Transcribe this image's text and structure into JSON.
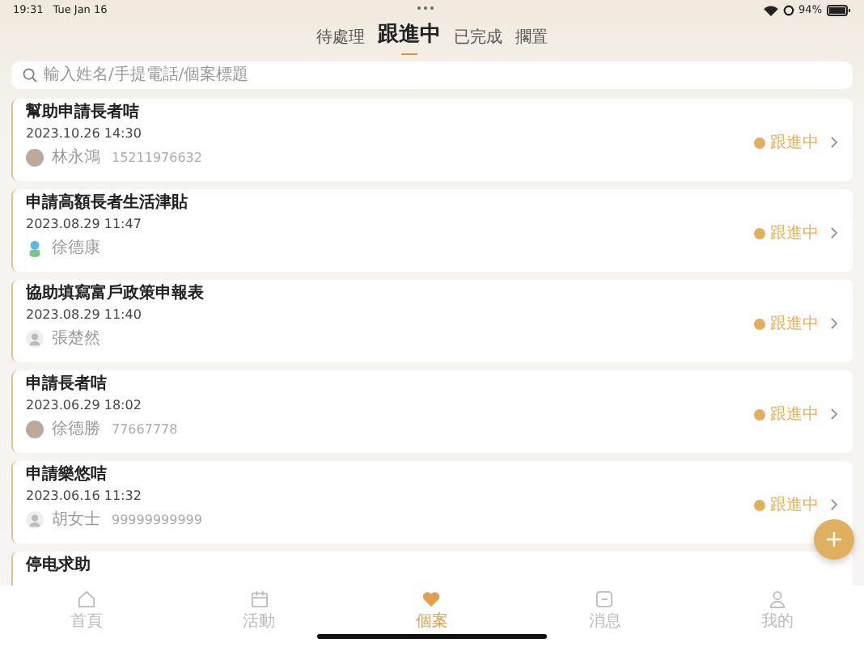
{
  "status_bar": {
    "time": "19:31",
    "date": "Tue Jan 16",
    "battery": "94%"
  },
  "tabs": [
    {
      "label": "待處理",
      "selected": false
    },
    {
      "label": "跟進中",
      "selected": true
    },
    {
      "label": "已完成",
      "selected": false
    },
    {
      "label": "擱置",
      "selected": false
    }
  ],
  "search": {
    "placeholder": "輸入姓名/手提電話/個案標題"
  },
  "cases": [
    {
      "title": "幫助申請長者咭",
      "time": "2023.10.26 14:30",
      "kind": "photo",
      "name": "林永鴻",
      "phone": "15211976632",
      "status": "跟進中"
    },
    {
      "title": "申請高額長者生活津貼",
      "time": "2023.08.29 11:47",
      "kind": "cartoon",
      "name": "徐德康",
      "status": "跟進中"
    },
    {
      "title": "協助填寫富戶政策申報表",
      "time": "2023.08.29 11:40",
      "kind": "default",
      "name": "張楚然",
      "status": "跟進中"
    },
    {
      "title": "申請長者咭",
      "time": "2023.06.29 18:02",
      "kind": "photo",
      "name": "徐德勝",
      "phone": "77667778",
      "status": "跟進中"
    },
    {
      "title": "申請樂悠咭",
      "time": "2023.06.16 11:32",
      "kind": "default",
      "name": "胡女士",
      "phone": "99999999999",
      "status": "跟進中"
    },
    {
      "title": "停电求助"
    }
  ],
  "nav": [
    {
      "label": "首頁",
      "kind": "home",
      "selected": false
    },
    {
      "label": "活動",
      "kind": "calendar",
      "selected": false
    },
    {
      "label": "個案",
      "kind": "heart",
      "selected": true
    },
    {
      "label": "消息",
      "kind": "message",
      "selected": false
    },
    {
      "label": "我的",
      "kind": "person",
      "selected": false
    }
  ]
}
